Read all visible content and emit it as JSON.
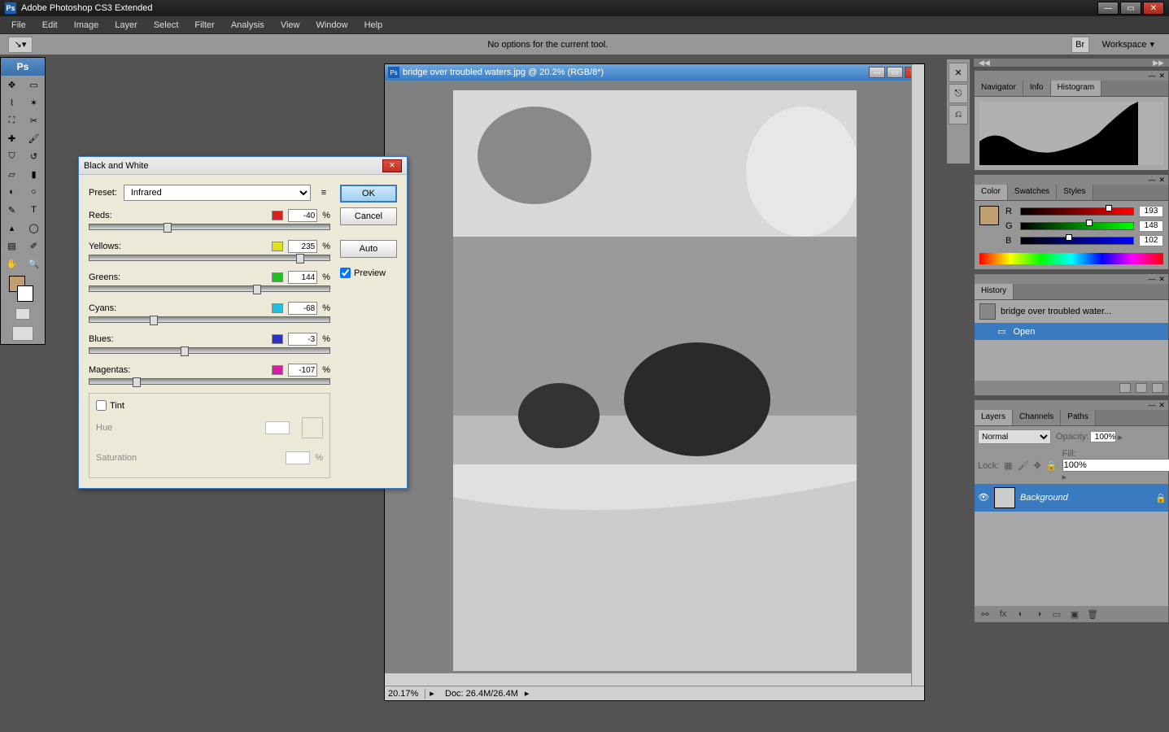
{
  "app": {
    "title": "Adobe Photoshop CS3 Extended"
  },
  "menu": [
    "File",
    "Edit",
    "Image",
    "Layer",
    "Select",
    "Filter",
    "Analysis",
    "View",
    "Window",
    "Help"
  ],
  "options": {
    "message": "No options for the current tool.",
    "workspace": "Workspace"
  },
  "document": {
    "title": "bridge over troubled waters.jpg @ 20.2% (RGB/8*)",
    "zoom": "20.17%",
    "docinfo": "Doc: 26.4M/26.4M"
  },
  "navigator": {
    "tabs": [
      "Navigator",
      "Info",
      "Histogram"
    ],
    "active": 2
  },
  "color": {
    "tabs": [
      "Color",
      "Swatches",
      "Styles"
    ],
    "r": 193,
    "g": 148,
    "b": 102,
    "swatch": "#c1946a"
  },
  "history": {
    "tab": "History",
    "docname": "bridge over troubled water...",
    "step": "Open"
  },
  "layers": {
    "tabs": [
      "Layers",
      "Channels",
      "Paths"
    ],
    "blend": "Normal",
    "opacity_label": "Opacity:",
    "opacity": "100%",
    "fill_label": "Fill:",
    "fill": "100%",
    "lock_label": "Lock:",
    "layer_name": "Background"
  },
  "bw": {
    "title": "Black and White",
    "preset_label": "Preset:",
    "preset": "Infrared",
    "ok": "OK",
    "cancel": "Cancel",
    "auto": "Auto",
    "preview": "Preview",
    "sliders": [
      {
        "label": "Reds:",
        "color": "#d92020",
        "value": "-40",
        "pos": 31
      },
      {
        "label": "Yellows:",
        "color": "#e0e020",
        "value": "235",
        "pos": 86
      },
      {
        "label": "Greens:",
        "color": "#20c020",
        "value": "144",
        "pos": 68
      },
      {
        "label": "Cyans:",
        "color": "#20c0e0",
        "value": "-68",
        "pos": 25
      },
      {
        "label": "Blues:",
        "color": "#3030c0",
        "value": "-3",
        "pos": 38
      },
      {
        "label": "Magentas:",
        "color": "#d020a0",
        "value": "-107",
        "pos": 18
      }
    ],
    "tint_label": "Tint",
    "hue_label": "Hue",
    "sat_label": "Saturation"
  }
}
